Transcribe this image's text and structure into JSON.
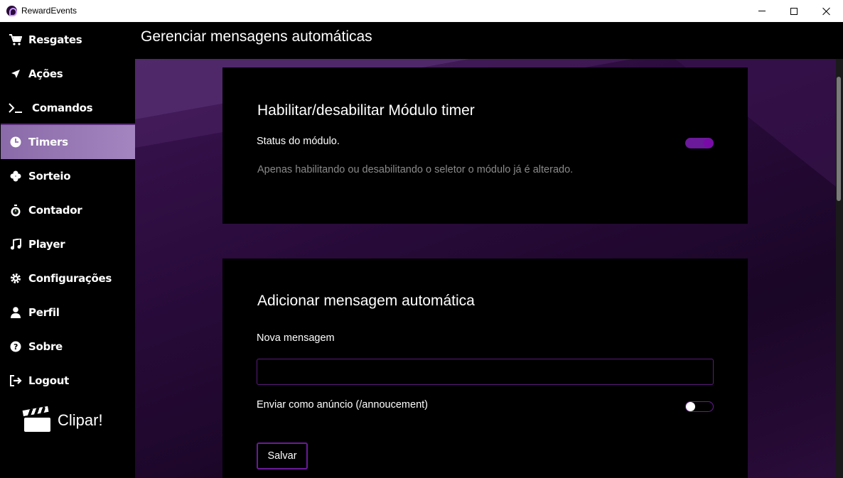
{
  "window": {
    "title": "RewardEvents",
    "icon": "app-logo-icon",
    "controls": [
      "minimize-icon",
      "maximize-icon",
      "close-icon"
    ]
  },
  "sidebar": {
    "items": [
      {
        "label": "Resgates",
        "icon": "cart-icon",
        "active": false
      },
      {
        "label": "Ações",
        "icon": "send-arrow-icon",
        "active": false
      },
      {
        "label": "Comandos",
        "icon": "terminal-icon",
        "active": false
      },
      {
        "label": "Timers",
        "icon": "clock-icon",
        "active": true
      },
      {
        "label": "Sorteio",
        "icon": "clover-icon",
        "active": false
      },
      {
        "label": "Contador",
        "icon": "stopwatch-icon",
        "active": false
      },
      {
        "label": "Player",
        "icon": "music-note-icon",
        "active": false
      },
      {
        "label": "Configurações",
        "icon": "gear-icon",
        "active": false
      },
      {
        "label": "Perfil",
        "icon": "user-icon",
        "active": false
      },
      {
        "label": "Sobre",
        "icon": "question-circle-icon",
        "active": false
      },
      {
        "label": "Logout",
        "icon": "logout-icon",
        "active": false
      }
    ],
    "clip_label": "Clipar!",
    "active_color": "#9a7ab6"
  },
  "header": {
    "title": "Gerenciar mensagens automáticas"
  },
  "module_card": {
    "title": "Habilitar/desabilitar Módulo timer",
    "status_label": "Status do módulo.",
    "status_enabled": true,
    "hint": "Apenas habilitando ou desabilitando o seletor o módulo já é alterado."
  },
  "add_card": {
    "title": "Adicionar mensagem automática",
    "new_message_label": "Nova mensagem",
    "new_message_value": "",
    "announce_label": "Enviar como anúncio (/annoucement)",
    "announce_enabled": false,
    "save_label": "Salvar"
  },
  "colors": {
    "accent": "#6a1a9a",
    "background": "#000000"
  }
}
